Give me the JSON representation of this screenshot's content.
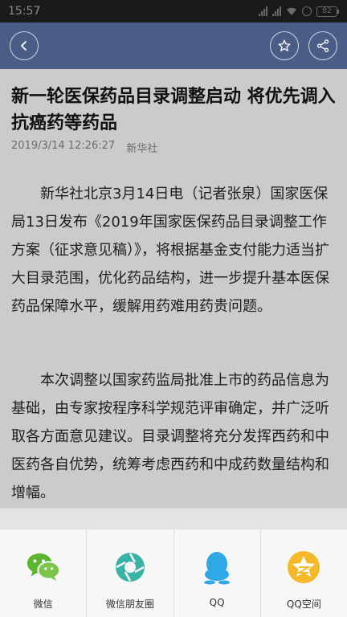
{
  "status_bar": {
    "time": "15:57",
    "battery": "82"
  },
  "article": {
    "title": "新一轮医保药品目录调整启动 将优先调入抗癌药等药品",
    "datetime": "2019/3/14 12:26:27",
    "source": "新华社",
    "paragraphs": [
      "新华社北京3月14日电（记者张泉）国家医保局13日发布《2019年国家医保药品目录调整工作方案（征求意见稿）》，将根据基金支付能力适当扩大目录范围，优化药品结构，进一步提升基本医保药品保障水平，缓解用药难用药贵问题。",
      "本次调整以国家药监局批准上市的药品信息为基础，由专家按程序科学规范评审确定，并广泛听取各方面意见建议。目录调整将充分发挥西药和中医药各自优势，统筹考虑西药和中成药数量结构和增幅。"
    ]
  },
  "share": {
    "items": [
      {
        "label": "微信",
        "icon": "wechat-icon",
        "color": "#5cb531"
      },
      {
        "label": "微信朋友圈",
        "icon": "moments-icon",
        "color": "#3ab3a7"
      },
      {
        "label": "QQ",
        "icon": "qq-icon",
        "color": "#2fa8e8"
      },
      {
        "label": "QQ空间",
        "icon": "qzone-icon",
        "color": "#f5b829"
      }
    ]
  },
  "colors": {
    "nav": "#4a5d86",
    "dim_bg": "#cbcbcb"
  }
}
